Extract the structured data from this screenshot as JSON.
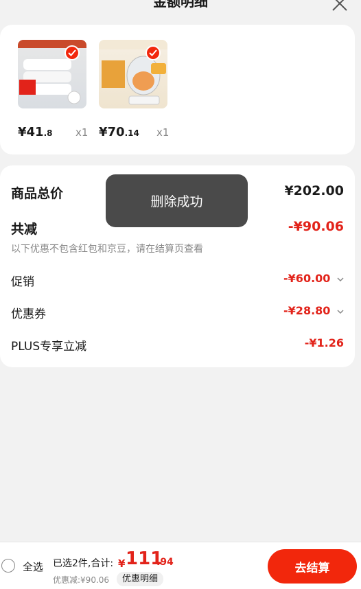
{
  "header": {
    "title": "金额明细"
  },
  "products": [
    {
      "price_int": "¥41",
      "price_dec": ".8",
      "qty": "x1"
    },
    {
      "price_int": "¥70",
      "price_dec": ".14",
      "qty": "x1"
    }
  ],
  "summary": {
    "total_label": "商品总价",
    "total_value": "¥202.00",
    "reduce_label": "共减",
    "reduce_value": "-¥90.06",
    "note": "以下优惠不包含红包和京豆，请在结算页查看",
    "items": [
      {
        "label": "促销",
        "value": "-¥60.00"
      },
      {
        "label": "优惠券",
        "value": "-¥28.80"
      },
      {
        "label": "PLUS专享立减",
        "value": "-¥1.26"
      }
    ]
  },
  "toast": {
    "text": "删除成功"
  },
  "bottom": {
    "select_all": "全选",
    "selected_text": "已选2件,合计:",
    "total_symbol": "¥",
    "total_int": "111",
    "total_dec": ".94",
    "discount_text": "优惠减:¥90.06",
    "detail_button": "优惠明细",
    "checkout_button": "去结算"
  },
  "colors": {
    "accent_red": "#e2231a",
    "toast_bg": "#4a4a4a"
  }
}
